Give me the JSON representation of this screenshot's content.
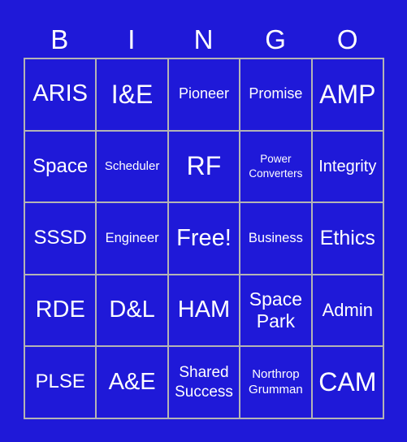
{
  "header": {
    "letters": [
      "B",
      "I",
      "N",
      "G",
      "O"
    ]
  },
  "colors": {
    "background": "#1f19d8",
    "grid_border": "#b4b4b4",
    "text": "#ffffff"
  },
  "board": {
    "rows": [
      [
        "ARIS",
        "I&E",
        "Pioneer",
        "Promise",
        "AMP"
      ],
      [
        "Space",
        "Scheduler",
        "RF",
        "Power Converters",
        "Integrity"
      ],
      [
        "SSSD",
        "Engineer",
        "Free!",
        "Business",
        "Ethics"
      ],
      [
        "RDE",
        "D&L",
        "HAM",
        "Space Park",
        "Admin"
      ],
      [
        "PLSE",
        "A&E",
        "Shared Success",
        "Northrop Grumman",
        "CAM"
      ]
    ]
  }
}
